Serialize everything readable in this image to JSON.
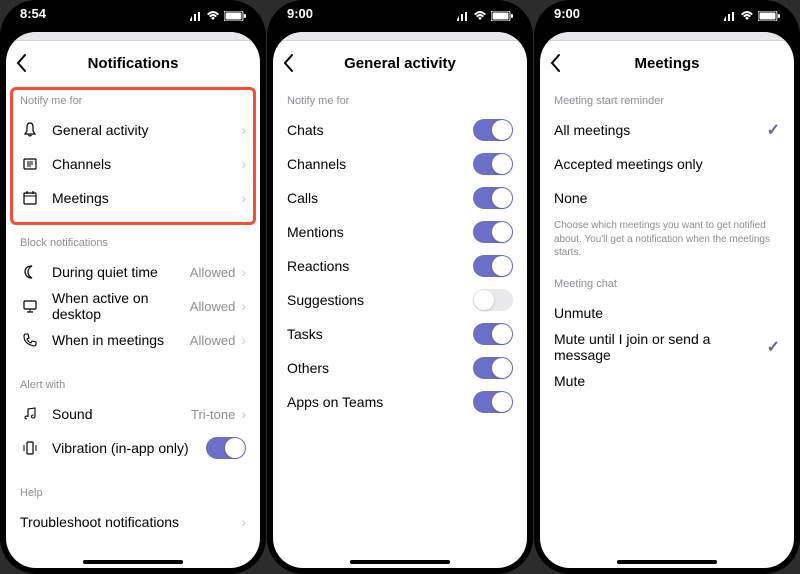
{
  "status": {
    "time1": "8:54",
    "time2": "9:00",
    "time3": "9:00"
  },
  "p1": {
    "title": "Notifications",
    "sectionNotify": "Notify me for",
    "notify": [
      {
        "label": "General activity"
      },
      {
        "label": "Channels"
      },
      {
        "label": "Meetings"
      }
    ],
    "sectionBlock": "Block notifications",
    "block": [
      {
        "label": "During quiet time",
        "value": "Allowed"
      },
      {
        "label": "When active on desktop",
        "value": "Allowed"
      },
      {
        "label": "When in meetings",
        "value": "Allowed"
      }
    ],
    "sectionAlert": "Alert with",
    "alert": [
      {
        "label": "Sound",
        "value": "Tri-tone"
      },
      {
        "label": "Vibration (in-app only)"
      }
    ],
    "sectionHelp": "Help",
    "help": [
      {
        "label": "Troubleshoot notifications"
      }
    ]
  },
  "p2": {
    "title": "General activity",
    "section": "Notify me for",
    "items": [
      {
        "label": "Chats",
        "on": true
      },
      {
        "label": "Channels",
        "on": true
      },
      {
        "label": "Calls",
        "on": true
      },
      {
        "label": "Mentions",
        "on": true
      },
      {
        "label": "Reactions",
        "on": true
      },
      {
        "label": "Suggestions",
        "on": false
      },
      {
        "label": "Tasks",
        "on": true
      },
      {
        "label": "Others",
        "on": true
      },
      {
        "label": "Apps on Teams",
        "on": true
      }
    ]
  },
  "p3": {
    "title": "Meetings",
    "sectionReminder": "Meeting start reminder",
    "reminder": [
      {
        "label": "All meetings",
        "checked": true
      },
      {
        "label": "Accepted meetings only",
        "checked": false
      },
      {
        "label": "None",
        "checked": false
      }
    ],
    "reminderDesc": "Choose which meetings you want to get notified about. You'll get a notification when the meetings starts.",
    "sectionChat": "Meeting chat",
    "chat": [
      {
        "label": "Unmute",
        "checked": false
      },
      {
        "label": "Mute until I join or send a message",
        "checked": true
      },
      {
        "label": "Mute",
        "checked": false
      }
    ]
  }
}
